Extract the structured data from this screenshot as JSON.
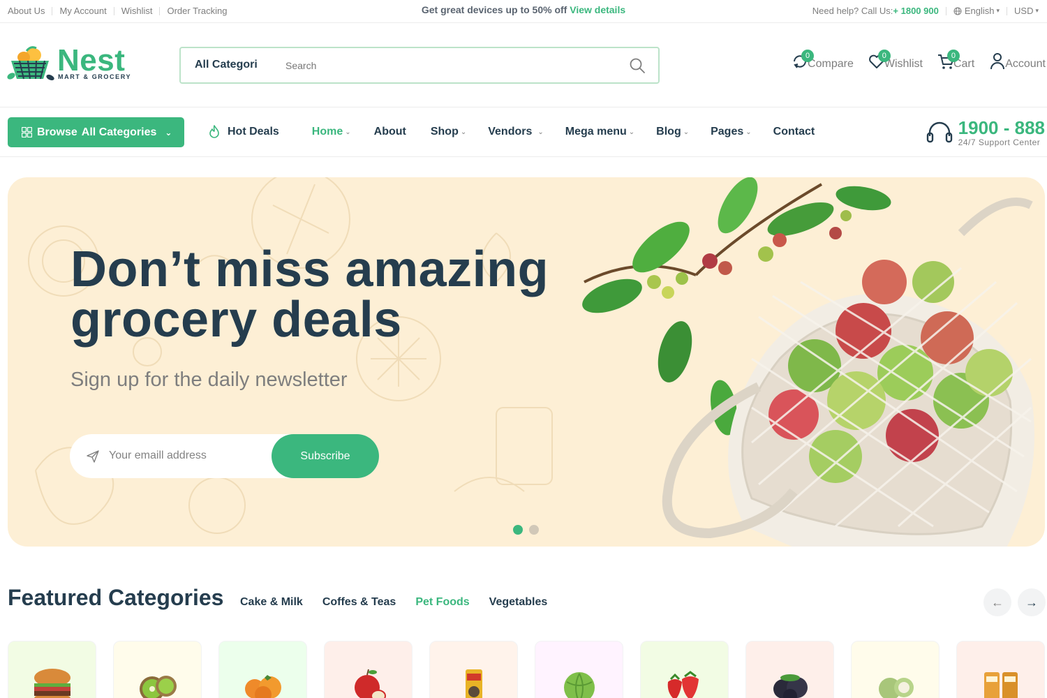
{
  "topbar": {
    "links": [
      "About Us",
      "My Account",
      "Wishlist",
      "Order Tracking"
    ],
    "promo_text": "Get great devices up to 50% off",
    "promo_link": "View details",
    "help_text": "Need help? Call Us:",
    "help_phone": "+ 1800 900",
    "language": "English",
    "currency": "USD"
  },
  "header": {
    "logo_word": "Nest",
    "logo_sub": "MART & GROCERY",
    "search_category": "All Categories",
    "search_placeholder": "Search",
    "icons": [
      {
        "label": "Compare",
        "count": "0",
        "icon": "compare-icon"
      },
      {
        "label": "Wishlist",
        "count": "0",
        "icon": "heart-icon"
      },
      {
        "label": "Cart",
        "count": "0",
        "icon": "cart-icon"
      },
      {
        "label": "Account",
        "icon": "user-icon"
      }
    ]
  },
  "nav": {
    "browse_label": "Browse",
    "browse_label_strong": "All Categories",
    "hot_deals": "Hot Deals",
    "items": [
      "Home",
      "About",
      "Shop",
      "Vendors",
      "Mega menu",
      "Blog",
      "Pages",
      "Contact"
    ],
    "support_number": "1900 - 888",
    "support_label": "24/7 Support Center"
  },
  "hero": {
    "headline_line1": "Don’t miss amazing",
    "headline_line2": "grocery deals",
    "subheadline": "Sign up for the daily newsletter",
    "email_placeholder": "Your emaill address",
    "subscribe_label": "Subscribe",
    "slide_count": 2,
    "active_slide": 1
  },
  "featured": {
    "title": "Featured Categories",
    "tabs": [
      "Cake & Milk",
      "Coffes & Teas",
      "Pet Foods",
      "Vegetables"
    ],
    "active_tab": "Pet Foods",
    "cards": [
      {
        "icon": "burger-icon",
        "bg": "#f2fce4"
      },
      {
        "icon": "kiwi-icon",
        "bg": "#fffceb"
      },
      {
        "icon": "persimmon-icon",
        "bg": "#ecffec"
      },
      {
        "icon": "apple-icon",
        "bg": "#feefea"
      },
      {
        "icon": "pet-food-icon",
        "bg": "#fff3eb"
      },
      {
        "icon": "cabbage-icon",
        "bg": "#fff3ff"
      },
      {
        "icon": "strawberry-icon",
        "bg": "#f2fce4"
      },
      {
        "icon": "plum-icon",
        "bg": "#feefea"
      },
      {
        "icon": "custard-apple-icon",
        "bg": "#fffceb"
      },
      {
        "icon": "snack-pack-icon",
        "bg": "#feefea"
      }
    ]
  },
  "colors": {
    "brand": "#3bb77e",
    "heading": "#253d4e",
    "muted": "#7e7e7e",
    "hero_bg": "#fdefd5"
  }
}
